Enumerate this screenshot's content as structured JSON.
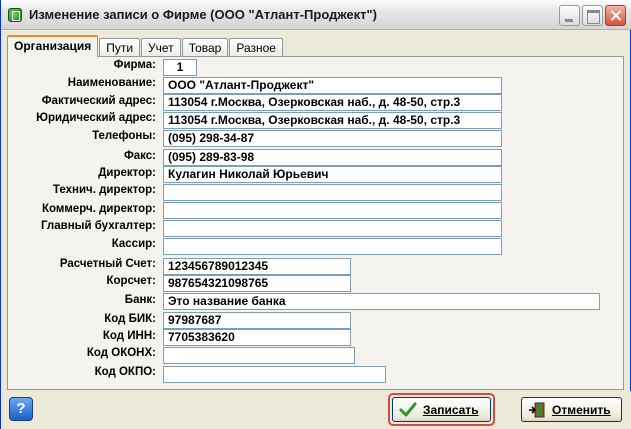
{
  "window": {
    "title": "Изменение записи о Фирме  (ООО \"Атлант-Проджект\")"
  },
  "tabs": [
    "Организация",
    "Пути",
    "Учет",
    "Товар",
    "Разное"
  ],
  "fields": {
    "firm": {
      "label": "Фирма:",
      "value": "1"
    },
    "name": {
      "label": "Наименование:",
      "value": "ООО \"Атлант-Проджект\""
    },
    "actual_address": {
      "label": "Фактический адрес:",
      "value": "113054 г.Москва, Озерковская наб., д. 48-50, стр.3"
    },
    "legal_address": {
      "label": "Юридический адрес:",
      "value": "113054 г.Москва, Озерковская наб., д. 48-50, стр.3"
    },
    "phones": {
      "label": "Телефоны:",
      "value": "(095) 298-34-87"
    },
    "fax": {
      "label": "Факс:",
      "value": "(095) 289-83-98"
    },
    "director": {
      "label": "Директор:",
      "value": "Кулагин Николай Юрьевич"
    },
    "tech_director": {
      "label": "Технич. директор:",
      "value": ""
    },
    "comm_director": {
      "label": "Коммерч. директор:",
      "value": ""
    },
    "chief_accountant": {
      "label": "Главный бухгалтер:",
      "value": ""
    },
    "cashier": {
      "label": "Кассир:",
      "value": ""
    },
    "settlement_account": {
      "label": "Расчетный Счет:",
      "value": "123456789012345"
    },
    "corr_account": {
      "label": "Корсчет:",
      "value": "987654321098765"
    },
    "bank": {
      "label": "Банк:",
      "value": "Это название банка"
    },
    "bik": {
      "label": "Код БИК:",
      "value": "97987687"
    },
    "inn": {
      "label": "Код ИНН:",
      "value": "7705383620"
    },
    "okonh": {
      "label": "Код ОКОНХ:",
      "value": ""
    },
    "okpo": {
      "label": "Код ОКПО:",
      "value": ""
    }
  },
  "buttons": {
    "help": "?",
    "save": "Записать",
    "cancel": "Отменить"
  },
  "colors": {
    "title_border": "#0831d9",
    "active_tab_accent": "#e68b2c",
    "save_focus": "#d24c4c"
  }
}
